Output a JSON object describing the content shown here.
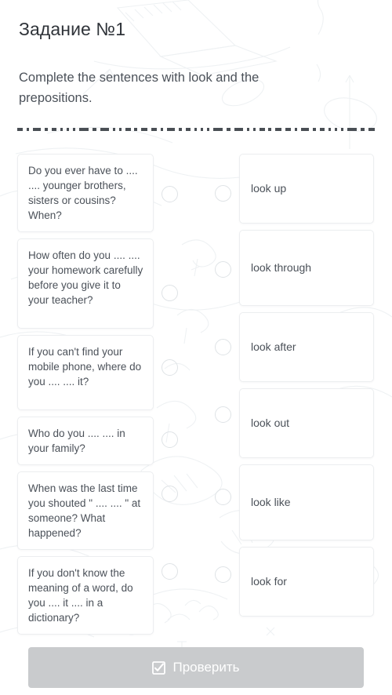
{
  "header": {
    "title": "Задание №1",
    "prompt": "Complete the sentences with look and the prepositions."
  },
  "questions": [
    {
      "text": "Do you ever have to .... .... younger brothers, sisters or cousins? When?"
    },
    {
      "text": "How often do you .... .... your homework carefully before you give it to your teacher?"
    },
    {
      "text": "If you can't find your mobile phone, where do you .... .... it?"
    },
    {
      "text": "Who do you .... .... in your family?"
    },
    {
      "text": "When was the last time you shouted \" .... .... \" at someone? What happened?"
    },
    {
      "text": "If you don't know the meaning of a word, do you .... it .... in a dictionary?"
    }
  ],
  "options": [
    {
      "label": "look up"
    },
    {
      "label": "look through"
    },
    {
      "label": "look after"
    },
    {
      "label": "look out"
    },
    {
      "label": "look like"
    },
    {
      "label": "look for"
    }
  ],
  "footer": {
    "check_label": "Проверить",
    "check_icon": "checkbox-checked-icon",
    "check_disabled_color": "#c9cbcd"
  },
  "colors": {
    "page_background": "#ffffff",
    "card_border": "#eceef0",
    "body_text": "#4b5159",
    "title_text": "#30343a",
    "dot_border": "#dfe3e6",
    "separator": "#4a4f55"
  }
}
